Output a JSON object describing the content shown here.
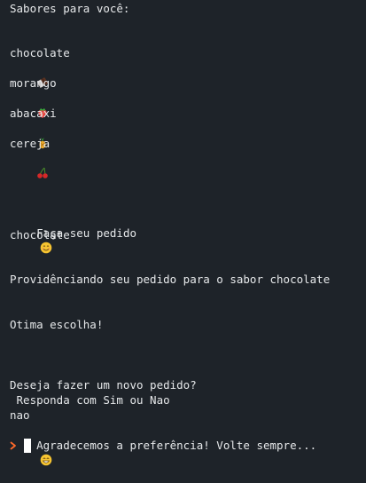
{
  "terminal": {
    "header": "Sabores para você:",
    "flavors": [
      {
        "name": "chocolate",
        "icon": "chocolate-bar-icon"
      },
      {
        "name": "morango",
        "icon": "strawberry-icon"
      },
      {
        "name": "abacaxi",
        "icon": "pineapple-icon"
      },
      {
        "name": "cereja",
        "icon": "cherries-icon"
      }
    ],
    "order_prompt": "Faça seu pedido",
    "order_prompt_icon": "smiling-face-icon",
    "order_input": "chocolate",
    "processing": "Providênciando seu pedido para o sabor chocolate",
    "great_choice": "Otima escolha!",
    "new_order_question": "Deseja fazer um novo pedido?",
    "answer_hint": " Responda com Sim ou Nao",
    "answer_input": "nao",
    "thanks": "Agradecemos a preferência! Volte sempre...",
    "thanks_icon": "grinning-face-icon",
    "prompt_icon": "prompt-chevron-icon",
    "colors": {
      "background": "#1e2329",
      "text": "#e6e8ea",
      "prompt": "#ff6a2a",
      "cursor": "#ffffff"
    }
  }
}
